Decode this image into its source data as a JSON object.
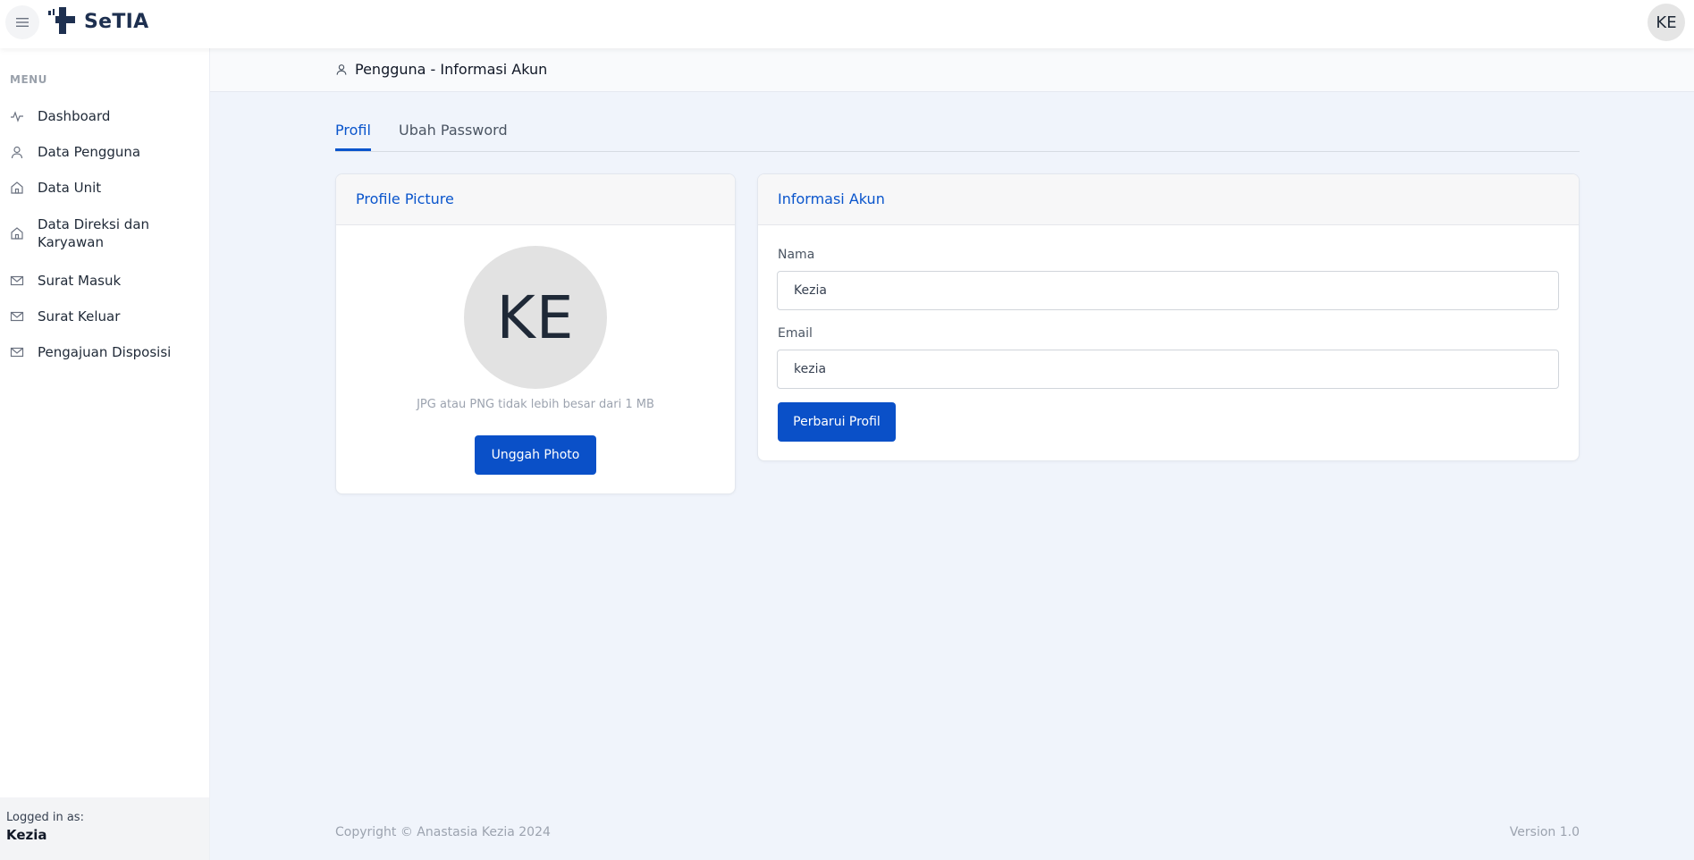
{
  "app": {
    "brand": "SeTIA",
    "user_initials": "KE"
  },
  "sidebar": {
    "heading": "MENU",
    "items": [
      {
        "label": "Dashboard",
        "icon": "activity-icon"
      },
      {
        "label": "Data Pengguna",
        "icon": "user-icon"
      },
      {
        "label": "Data Unit",
        "icon": "home-icon"
      },
      {
        "label": "Data Direksi dan Karyawan",
        "icon": "home-icon"
      },
      {
        "label": "Surat Masuk",
        "icon": "mail-icon"
      },
      {
        "label": "Surat Keluar",
        "icon": "mail-icon"
      },
      {
        "label": "Pengajuan Disposisi",
        "icon": "mail-icon"
      }
    ],
    "logged_in_label": "Logged in as:",
    "logged_in_user": "Kezia"
  },
  "header": {
    "title": "Pengguna - Informasi Akun"
  },
  "tabs": [
    {
      "label": "Profil",
      "active": true
    },
    {
      "label": "Ubah Password",
      "active": false
    }
  ],
  "profile_card": {
    "title": "Profile Picture",
    "initials": "KE",
    "hint": "JPG atau PNG tidak lebih besar dari 1 MB",
    "upload_label": "Unggah Photo"
  },
  "account_card": {
    "title": "Informasi Akun",
    "name_label": "Nama",
    "name_value": "Kezia",
    "email_label": "Email",
    "email_value": "kezia",
    "submit_label": "Perbarui Profil"
  },
  "footer": {
    "copyright": "Copyright © Anastasia Kezia 2024",
    "version": "Version 1.0"
  },
  "colors": {
    "accent": "#0a55cc",
    "button": "#0a50c8",
    "brand_dark": "#1e3050",
    "page_bg": "#f0f4fb"
  }
}
